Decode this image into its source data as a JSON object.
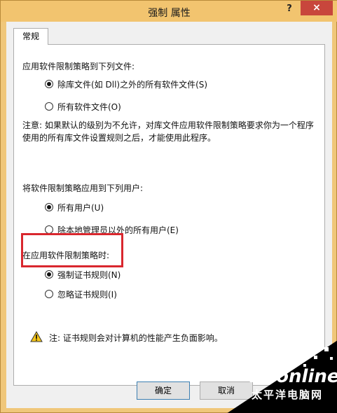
{
  "window": {
    "title": "强制 属性",
    "help_label": "?",
    "close_label": "×"
  },
  "tabs": [
    {
      "label": "常规"
    }
  ],
  "section1": {
    "heading": "应用软件限制策略到下列文件:",
    "options": [
      {
        "label": "除库文件(如 Dll)之外的所有软件文件(S)",
        "checked": true
      },
      {
        "label": "所有软件文件(O)",
        "checked": false
      }
    ]
  },
  "note": {
    "line1": "注意: 如果默认的级别为不允许，对库文件应用软件限制策略要求你为一个程序",
    "line2": "使用的所有库文件设置规则之后，才能使用此程序。"
  },
  "section2": {
    "heading": "将软件限制策略应用到下列用户:",
    "options": [
      {
        "label": "所有用户(U)",
        "checked": true
      },
      {
        "label": "除本地管理员以外的所有用户(E)",
        "checked": false
      }
    ]
  },
  "section3": {
    "heading": "在应用软件限制策略时:",
    "options": [
      {
        "label": "强制证书规则(N)",
        "checked": true
      },
      {
        "label": "忽略证书规则(I)",
        "checked": false
      }
    ]
  },
  "warning": {
    "icon": "warning-icon",
    "text": "注: 证书规则会对计算机的性能产生负面影响。"
  },
  "buttons": {
    "ok": "确定",
    "cancel": "取消"
  },
  "watermark": {
    "brand": "PConline",
    "subtitle": "太平洋电脑网"
  },
  "colors": {
    "title_bar": "#f2c46f",
    "close_button": "#c8463c",
    "highlight_box": "#d9272e"
  }
}
